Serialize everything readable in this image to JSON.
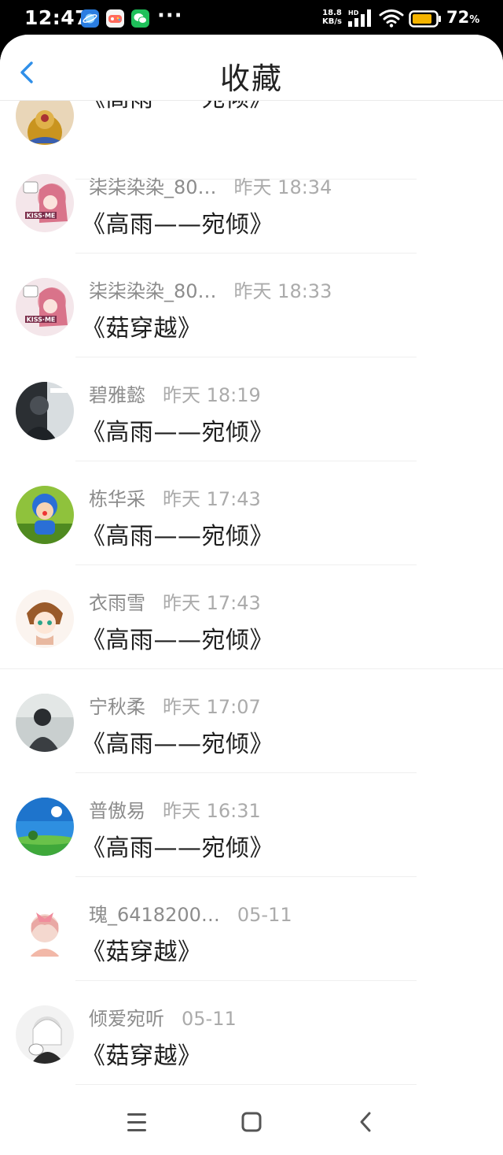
{
  "status_bar": {
    "time": "12:47",
    "net_speed_value": "18.8",
    "net_speed_unit": "KB/s",
    "network_type": "HD",
    "battery_percent": "72",
    "battery_percent_sign": "%"
  },
  "header": {
    "title": "收藏",
    "back_icon": "chevron-left-icon",
    "accent_color": "#2f8fe8"
  },
  "items": [
    {
      "name": "",
      "time": "",
      "song": "《高雨——宛倾》"
    },
    {
      "name": "柒柒染染_80…",
      "time": "昨天 18:34",
      "song": "《高雨——宛倾》"
    },
    {
      "name": "柒柒染染_80…",
      "time": "昨天 18:33",
      "song": "《菇穿越》"
    },
    {
      "name": "碧雅懿",
      "time": "昨天 18:19",
      "song": "《高雨——宛倾》"
    },
    {
      "name": "栋华采",
      "time": "昨天 17:43",
      "song": "《高雨——宛倾》"
    },
    {
      "name": "衣雨雪",
      "time": "昨天 17:43",
      "song": "《高雨——宛倾》"
    },
    {
      "name": "宁秋柔",
      "time": "昨天 17:07",
      "song": "《高雨——宛倾》"
    },
    {
      "name": "普傲易",
      "time": "昨天 16:31",
      "song": "《高雨——宛倾》"
    },
    {
      "name": "瑰_6418200…",
      "time": "05-11",
      "song": "《菇穿越》"
    },
    {
      "name": "倾爱宛听",
      "time": "05-11",
      "song": "《菇穿越》"
    }
  ],
  "nav_bar": {
    "menu_icon": "menu-icon",
    "home_icon": "home-square-icon",
    "back_icon": "back-chevron-icon"
  }
}
